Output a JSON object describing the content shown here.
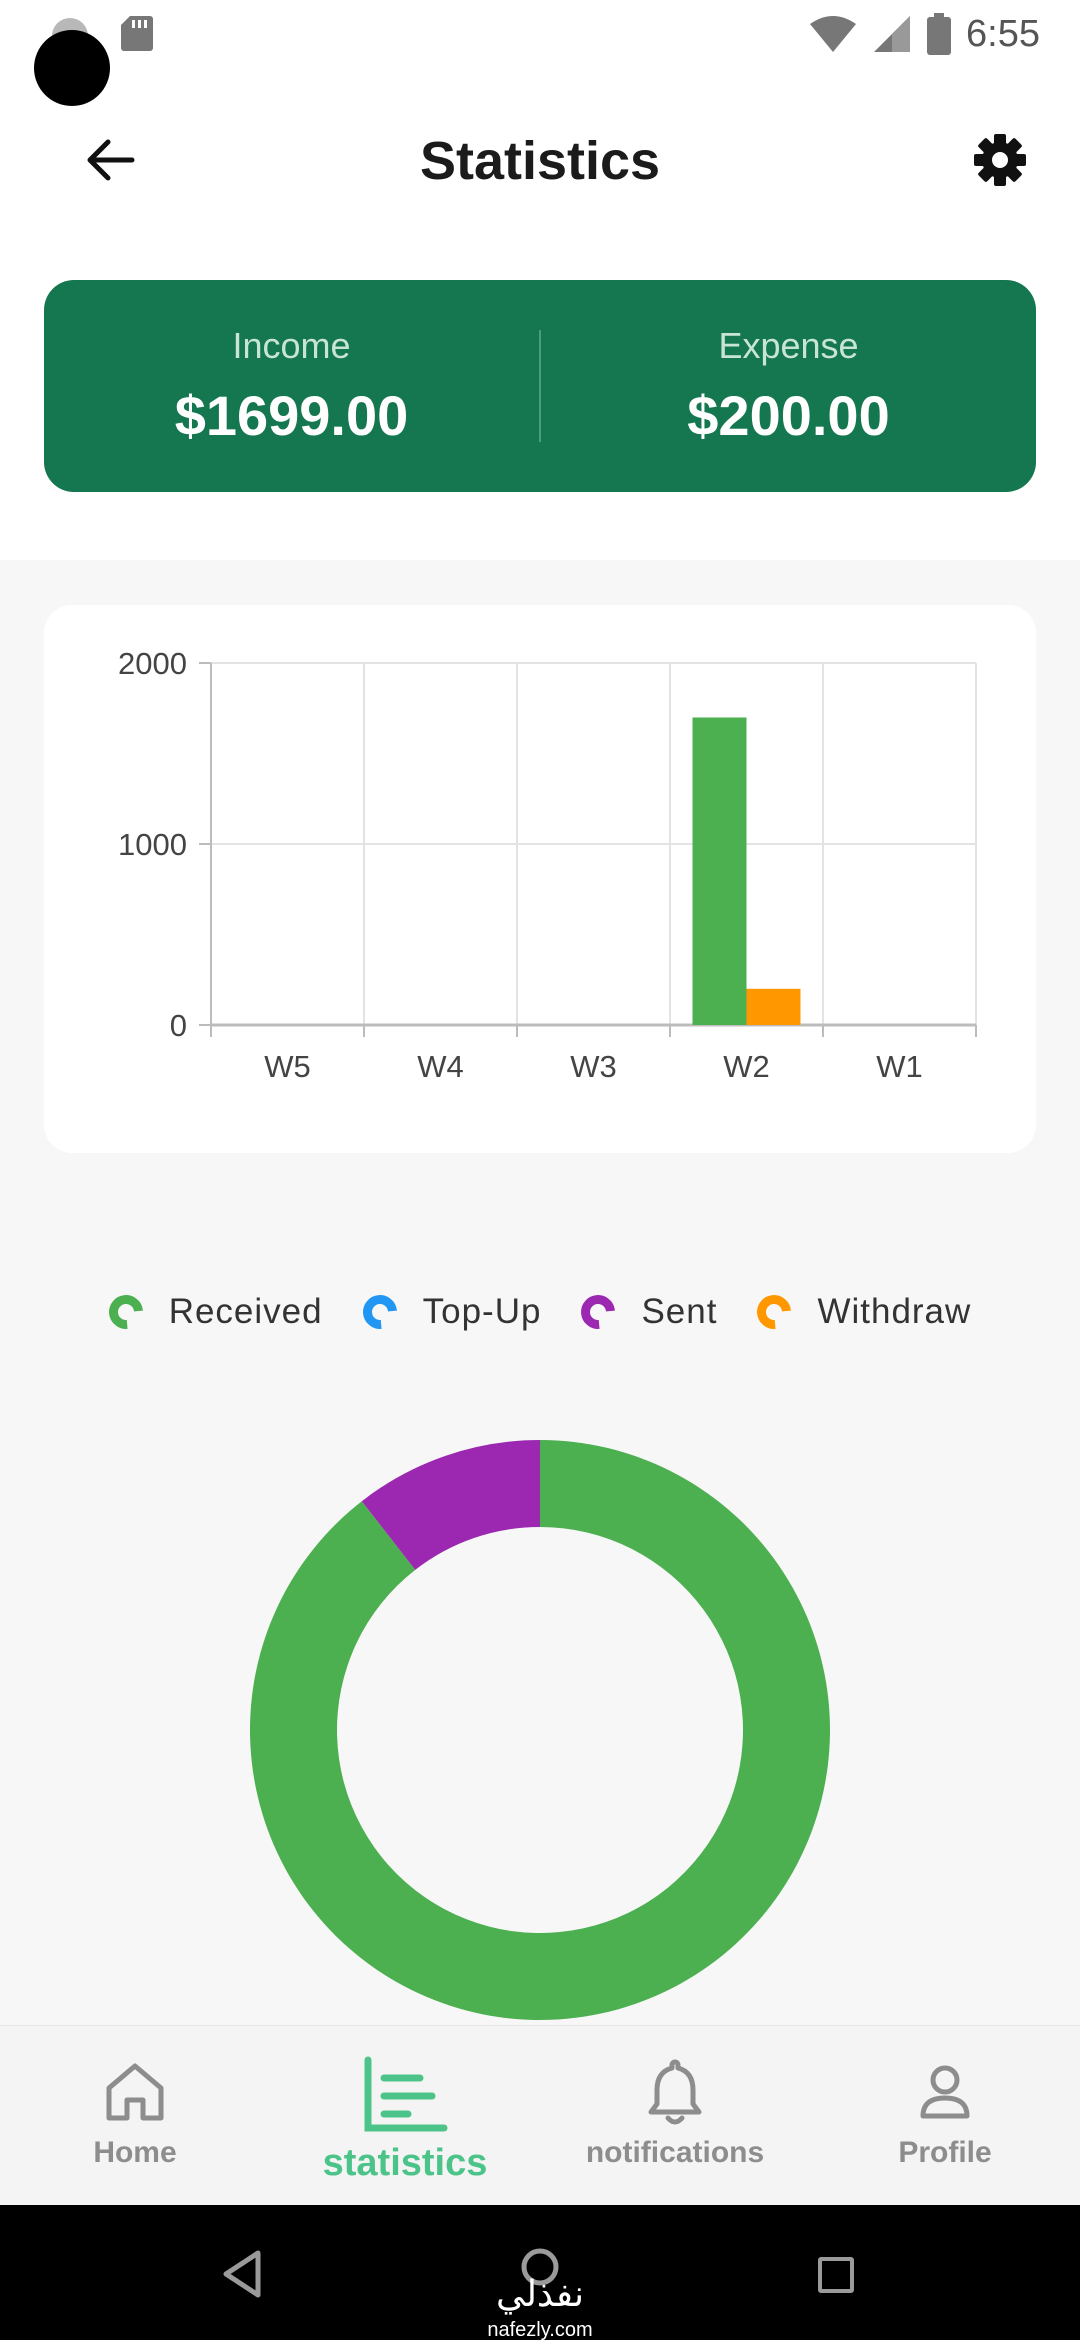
{
  "status_bar": {
    "time": "6:55"
  },
  "header": {
    "title": "Statistics"
  },
  "summary": {
    "income_label": "Income",
    "income_value": "$1699.00",
    "expense_label": "Expense",
    "expense_value": "$200.00"
  },
  "chart_data": [
    {
      "type": "bar",
      "categories": [
        "W5",
        "W4",
        "W3",
        "W2",
        "W1"
      ],
      "series": [
        {
          "values": [
            0,
            0,
            0,
            1699,
            0
          ],
          "color": "#4caf50"
        },
        {
          "values": [
            0,
            0,
            0,
            200,
            0
          ],
          "color": "#ff9800"
        }
      ],
      "y_ticks": [
        0,
        1000,
        2000
      ],
      "ylim": [
        0,
        2000
      ],
      "grid": true,
      "title": "",
      "xlabel": "",
      "ylabel": ""
    },
    {
      "type": "pie",
      "style": "donut",
      "legend_position": "top",
      "legend": [
        {
          "label": "Received",
          "color": "#4caf50"
        },
        {
          "label": "Top-Up",
          "color": "#2196f3"
        },
        {
          "label": "Sent",
          "color": "#9c27b0"
        },
        {
          "label": "Withdraw",
          "color": "#ff9800"
        }
      ],
      "slices": [
        {
          "label": "Received",
          "value": 1699,
          "color": "#4caf50"
        },
        {
          "label": "Top-Up",
          "value": 0,
          "color": "#2196f3"
        },
        {
          "label": "Sent",
          "value": 200,
          "color": "#9c27b0"
        },
        {
          "label": "Withdraw",
          "value": 0,
          "color": "#ff9800"
        }
      ]
    }
  ],
  "bottom_nav": {
    "items": [
      {
        "label": "Home",
        "icon": "home-icon"
      },
      {
        "label": "statistics",
        "icon": "statistics-icon",
        "active": true
      },
      {
        "label": "notifications",
        "icon": "bell-icon"
      },
      {
        "label": "Profile",
        "icon": "profile-icon"
      }
    ]
  },
  "watermark": {
    "arabic": "نفذلي",
    "latin": "nafezly.com"
  },
  "colors": {
    "primary": "#15774f",
    "accent": "#4cc489",
    "received": "#4caf50",
    "sent": "#9c27b0",
    "topup": "#2196f3",
    "withdraw": "#ff9800"
  }
}
